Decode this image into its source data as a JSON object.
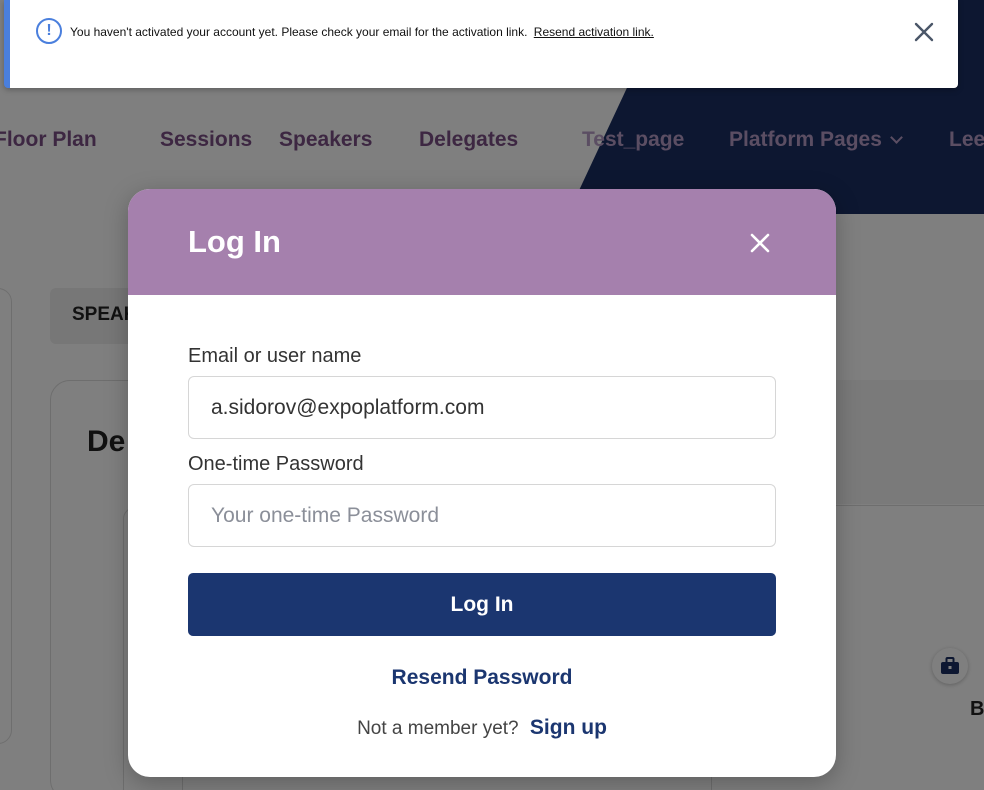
{
  "background": {
    "nav": [
      "Floor Plan",
      "Sessions",
      "Speakers",
      "Delegates",
      "Test_page",
      "Platform Pages",
      "Lee"
    ],
    "speakers_tab_partial": "SPEAK",
    "section_title_partial": "De",
    "card_letter_partial": "B"
  },
  "banner": {
    "message": "You haven't activated your account yet. Please check your email for the activation link.",
    "link": "Resend activation link.",
    "icon": "info-icon",
    "accent_color": "#4a7fdd"
  },
  "modal": {
    "title": "Log In",
    "header_color": "#a580ad",
    "email_label": "Email or user name",
    "email_value": "a.sidorov@expoplatform.com",
    "password_label": "One-time Password",
    "password_placeholder": "Your one-time Password",
    "login_button": "Log In",
    "button_color": "#1b3670",
    "resend_link": "Resend Password",
    "signup_prompt": "Not a member yet?",
    "signup_link": "Sign up"
  }
}
